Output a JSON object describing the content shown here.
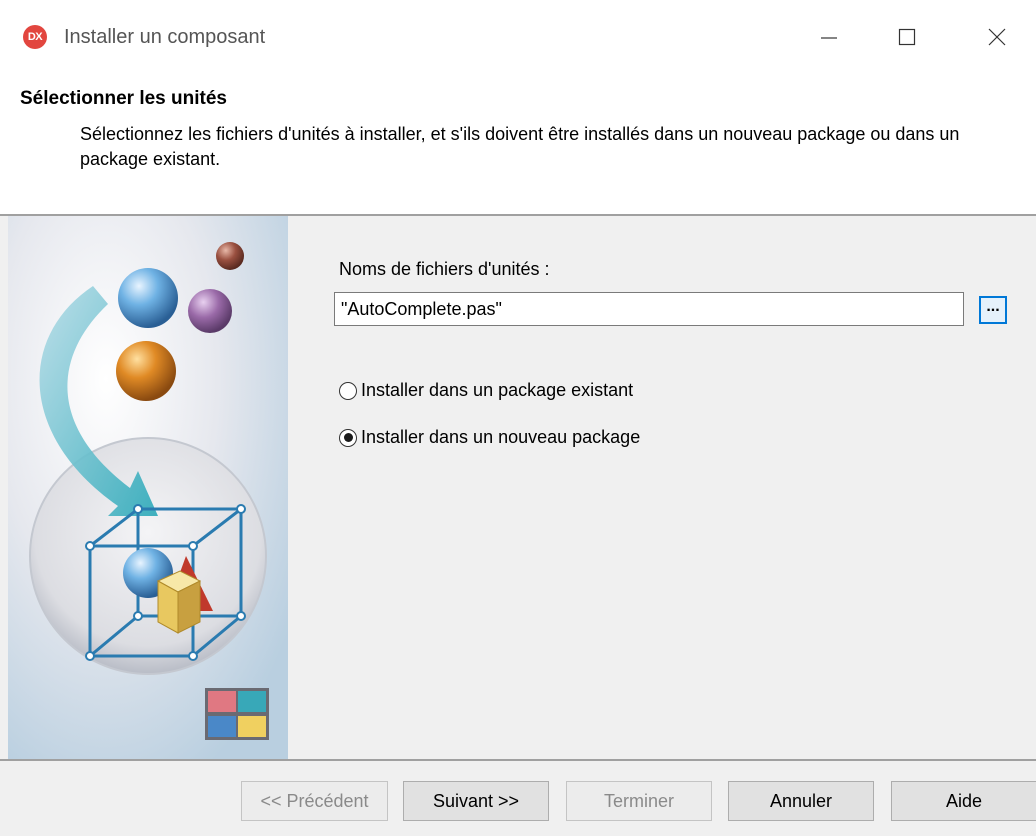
{
  "window": {
    "title": "Installer un composant",
    "app_icon_text": "DX"
  },
  "header": {
    "title": "Sélectionner les unités",
    "description": "Sélectionnez les fichiers d'unités à installer, et s'ils doivent être installés dans un nouveau package ou dans un package existant."
  },
  "form": {
    "files_label": "Noms de fichiers d'unités :",
    "files_value": "\"AutoComplete.pas\"",
    "browse_label": "...",
    "radio_existing": {
      "label": "Installer dans un package existant",
      "checked": false
    },
    "radio_new": {
      "label": "Installer dans un nouveau package",
      "checked": true
    }
  },
  "footer": {
    "prev_label": "<< Précédent",
    "next_label": "Suivant >>",
    "finish_label": "Terminer",
    "cancel_label": "Annuler",
    "help_label": "Aide"
  },
  "colors": {
    "accent": "#0078d7",
    "panel_bg": "#f0f0f0",
    "icon_red": "#e2463f"
  }
}
